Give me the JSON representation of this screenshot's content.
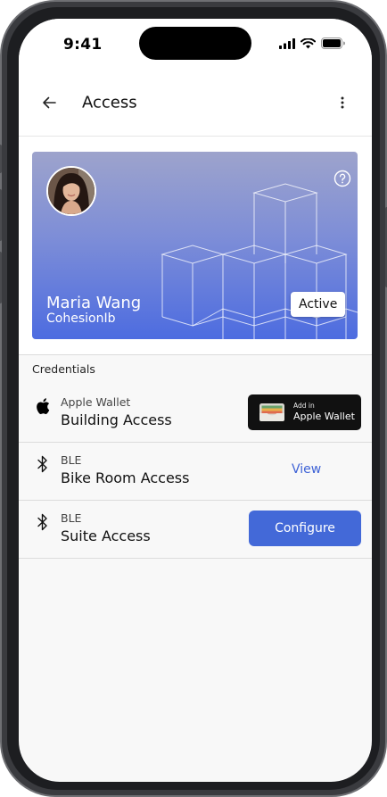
{
  "status_bar": {
    "time": "9:41"
  },
  "app_bar": {
    "title": "Access"
  },
  "profile_card": {
    "name": "Maria Wang",
    "organization": "CohesionIb",
    "status": "Active",
    "gradient_top": "#9da3cc",
    "gradient_bottom": "#4d6ce0"
  },
  "credentials": {
    "header": "Credentials",
    "items": [
      {
        "type": "Apple Wallet",
        "name": "Building Access",
        "icon": "apple-icon",
        "action": "add-to-apple-wallet"
      },
      {
        "type": "BLE",
        "name": "Bike Room Access",
        "icon": "bluetooth-icon",
        "action": "view"
      },
      {
        "type": "BLE",
        "name": "Suite Access",
        "icon": "bluetooth-icon",
        "action": "configure"
      }
    ]
  },
  "wallet_button": {
    "small_text": "Add in",
    "large_text": "Apple Wallet"
  },
  "view_link": "View",
  "configure_button": "Configure",
  "colors": {
    "accent": "#4369d8",
    "link": "#3f63d6",
    "wallet_button": "#111111"
  }
}
